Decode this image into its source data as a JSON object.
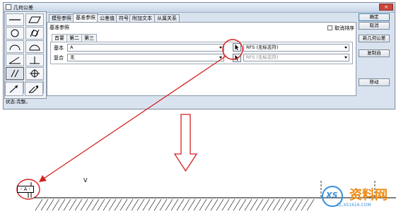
{
  "window": {
    "title": "几何公差",
    "close_label": "×"
  },
  "tabs": [
    {
      "label": "模型参照",
      "active": false
    },
    {
      "label": "基准参照",
      "active": true
    },
    {
      "label": "公差值",
      "active": false
    },
    {
      "label": "符号",
      "active": false
    },
    {
      "label": "附加文本",
      "active": false
    },
    {
      "label": "从属关系",
      "active": false
    }
  ],
  "panel": {
    "group_label": "基准参照",
    "checkbox_label": "取消排序",
    "subtabs": [
      {
        "label": "首要",
        "active": true
      },
      {
        "label": "第二",
        "active": false
      },
      {
        "label": "第三",
        "active": false
      }
    ],
    "basic_label": "基本",
    "basic_value": "A",
    "basic_modifier": "RFS (无标志符)",
    "compound_label": "复合",
    "compound_value": "无",
    "compound_modifier": "RFS (无标志符)"
  },
  "buttons": {
    "ok": "确定",
    "cancel": "取消",
    "new": "新几何公差",
    "copy": "复制自",
    "move": "移动"
  },
  "status": "状态:完整。",
  "drawing": {
    "datum_tag": "- A -",
    "tick_label": "V"
  },
  "watermark": {
    "text": "资料网",
    "url": "ZL.XS1616.COM",
    "logo": "XS"
  },
  "colors": {
    "arrow": "#d42020",
    "highlight_circle": "#d42020",
    "watermark": "#f08a10"
  }
}
